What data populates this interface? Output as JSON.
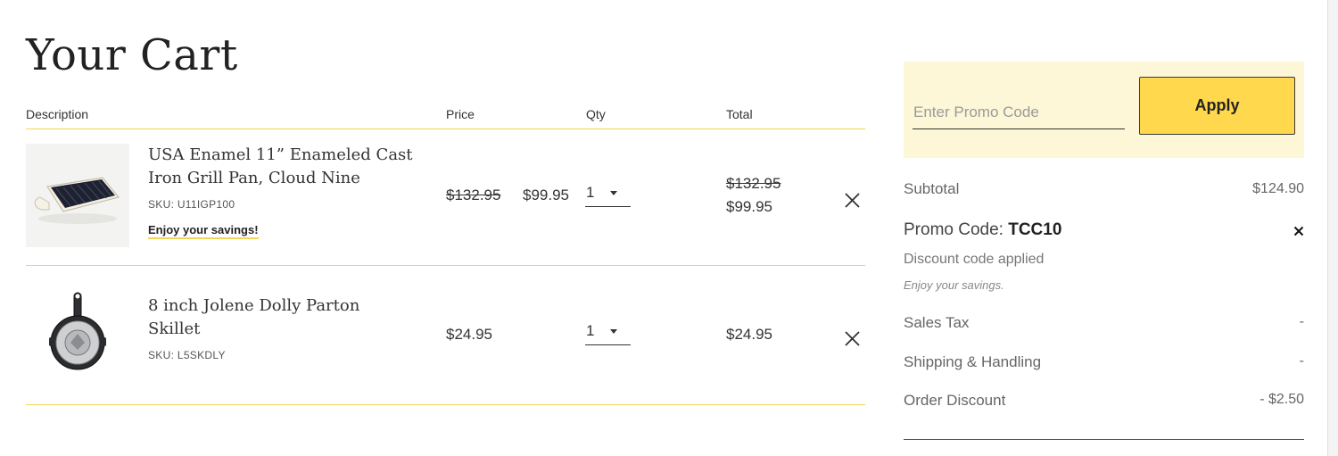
{
  "page": {
    "title": "Your Cart"
  },
  "table": {
    "headers": {
      "description": "Description",
      "price": "Price",
      "qty": "Qty",
      "total": "Total"
    }
  },
  "items": [
    {
      "name": "USA Enamel 11” Enameled Cast Iron Grill Pan, Cloud Nine",
      "sku": "SKU: U11IGP100",
      "savings_link": "Enjoy your savings!",
      "price_original": "$132.95",
      "price": "$99.95",
      "qty": "1",
      "total_original": "$132.95",
      "total": "$99.95",
      "image": "grill-pan-image"
    },
    {
      "name": "8 inch Jolene Dolly Parton Skillet",
      "sku": "SKU: L5SKDLY",
      "price": "$24.95",
      "qty": "1",
      "total": "$24.95",
      "image": "skillet-image"
    }
  ],
  "promo": {
    "placeholder": "Enter Promo Code",
    "apply_label": "Apply"
  },
  "summary": {
    "subtotal_label": "Subtotal",
    "subtotal_value": "$124.90",
    "promo_code_label": "Promo Code:",
    "promo_code_value": "TCC10",
    "discount_note": "Discount code applied",
    "discount_subnote": "Enjoy your savings.",
    "sales_tax_label": "Sales Tax",
    "sales_tax_value": "-",
    "shipping_label": "Shipping & Handling",
    "shipping_value": "-",
    "order_discount_label": "Order Discount",
    "order_discount_value": "- $2.50"
  },
  "colors": {
    "accent": "#ffd84d",
    "promo_bg": "#fdf6d7",
    "rule": "#f2d55a"
  }
}
